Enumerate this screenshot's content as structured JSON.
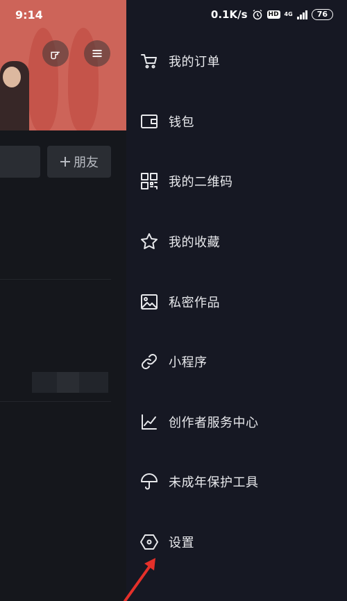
{
  "status_bar": {
    "time": "9:14",
    "network_speed": "0.1K/s",
    "hd_label": "HD",
    "net_type": "4G",
    "battery": "76"
  },
  "left_panel": {
    "add_friend_label": "朋友",
    "add_icon": "plus-icon"
  },
  "drawer": {
    "items": [
      {
        "label": "我的订单",
        "icon": "cart-icon"
      },
      {
        "label": "钱包",
        "icon": "wallet-icon"
      },
      {
        "label": "我的二维码",
        "icon": "qr-code-icon"
      },
      {
        "label": "我的收藏",
        "icon": "star-icon"
      },
      {
        "label": "私密作品",
        "icon": "image-icon"
      },
      {
        "label": "小程序",
        "icon": "link-icon"
      },
      {
        "label": "创作者服务中心",
        "icon": "chart-line-icon"
      },
      {
        "label": "未成年保护工具",
        "icon": "umbrella-icon"
      },
      {
        "label": "设置",
        "icon": "settings-hex-icon"
      }
    ]
  },
  "colors": {
    "drawer_bg": "#161823",
    "annotation_arrow": "#e5302a"
  }
}
